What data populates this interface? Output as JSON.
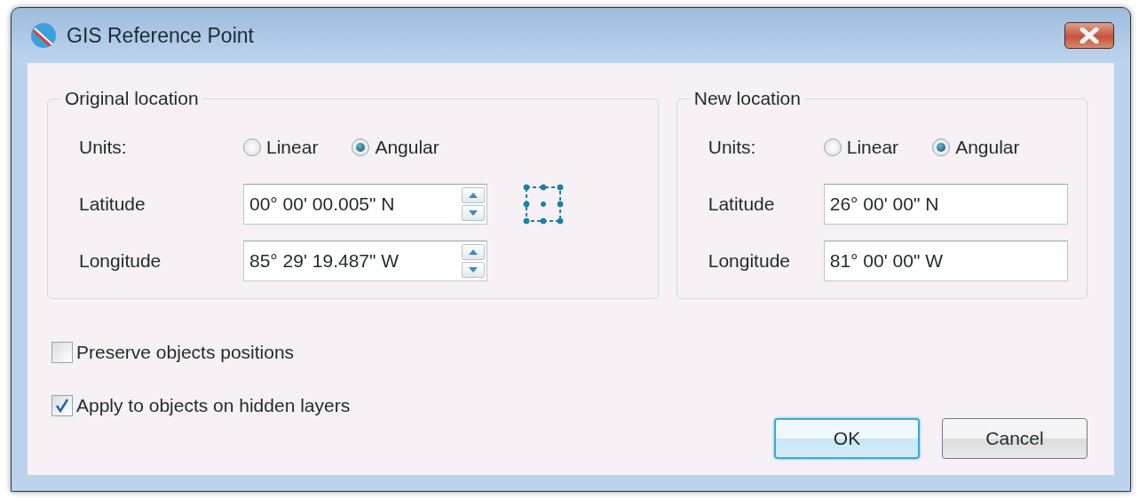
{
  "window": {
    "title": "GIS Reference Point"
  },
  "original_location": {
    "title": "Original location",
    "units_label": "Units:",
    "units": [
      {
        "label": "Linear",
        "selected": false
      },
      {
        "label": "Angular",
        "selected": true
      }
    ],
    "fields": [
      {
        "label": "Latitude",
        "value": "00° 00' 00.005\" N",
        "kind": "spinner"
      },
      {
        "label": "Longitude",
        "value": "85° 29' 19.487\" W",
        "kind": "spinner"
      }
    ]
  },
  "new_location": {
    "title": "New location",
    "units_label": "Units:",
    "units": [
      {
        "label": "Linear",
        "selected": false
      },
      {
        "label": "Angular",
        "selected": true
      }
    ],
    "fields": [
      {
        "label": "Latitude",
        "value": "26° 00' 00\" N",
        "kind": "text"
      },
      {
        "label": "Longitude",
        "value": "81° 00' 00\" W",
        "kind": "text"
      }
    ]
  },
  "options": [
    {
      "label": "Preserve objects positions",
      "checked": false
    },
    {
      "label": "Apply to objects on hidden layers",
      "checked": true
    }
  ],
  "buttons": [
    {
      "label": "OK",
      "default": true
    },
    {
      "label": "Cancel",
      "default": false
    }
  ]
}
